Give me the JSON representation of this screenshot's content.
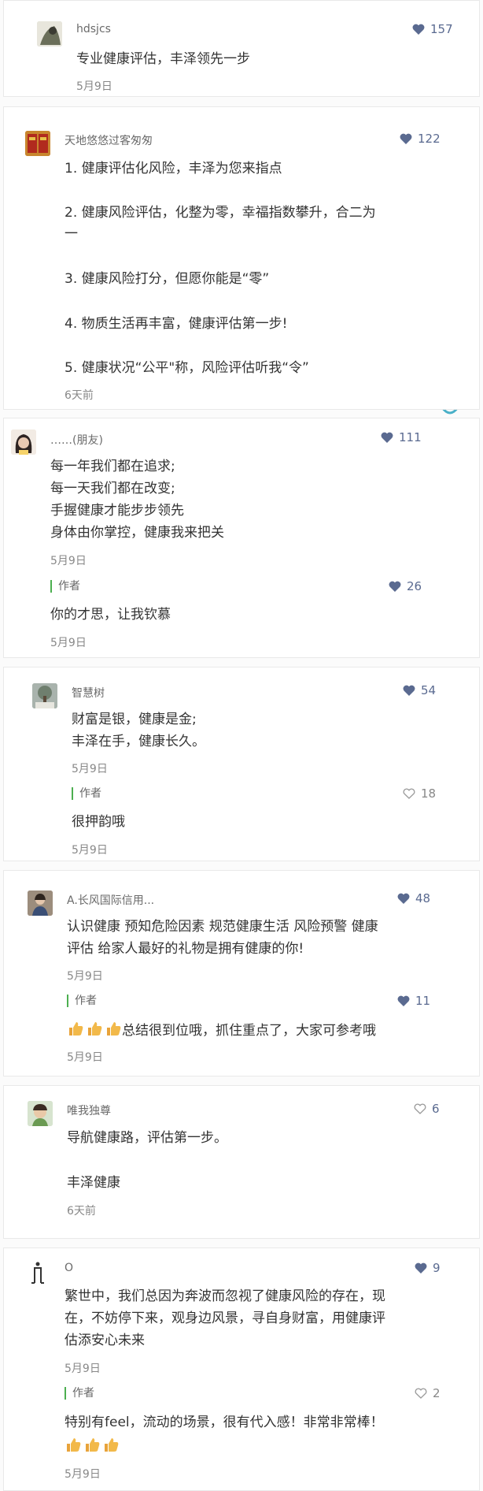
{
  "comments": [
    {
      "user": "hdsjcs",
      "likes": "157",
      "lines": [
        "专业健康评估，丰泽领先一步"
      ],
      "date": "5月9日"
    },
    {
      "user": "天地悠悠过客匆匆",
      "likes": "122",
      "lines": [
        "1.  健康评估化风险，丰泽为您来指点",
        "2.  健康风险评估，化整为零，幸福指数攀升，合二为",
        "一",
        "3.    健康风险打分，但愿你能是“零”",
        "4.    物质生活再丰富，健康评估第一步!",
        "5.    健康状况“公平\"称，风险评估听我“令”"
      ],
      "date": "6天前"
    },
    {
      "user": "……(朋友)",
      "likes": "111",
      "lines": [
        "每一年我们都在追求;",
        "每一天我们都在改变;",
        "手握健康才能步步领先",
        "身体由你掌控，健康我来把关"
      ],
      "date": "5月9日",
      "reply": {
        "tag": "作者",
        "likes": "26",
        "text": "你的才思，让我钦慕",
        "date": "5月9日"
      }
    },
    {
      "user": "智慧树",
      "likes": "54",
      "lines": [
        "财富是银，健康是金;",
        "丰泽在手，健康长久。"
      ],
      "date": "5月9日",
      "reply": {
        "tag": "作者",
        "likes": "18",
        "text": "很押韵哦",
        "date": "5月9日"
      }
    },
    {
      "user": "A.长风国际信用...",
      "likes": "48",
      "lines": [
        "认识健康 预知危险因素 规范健康生活 风险预警 健康",
        "评估 给家人最好的礼物是拥有健康的你!"
      ],
      "date": "5月9日",
      "reply": {
        "tag": "作者",
        "likes": "11",
        "text": "总结很到位哦，抓住重点了，大家可参考哦",
        "date": "5月9日"
      }
    },
    {
      "user": "唯我独尊",
      "likes": "6",
      "lines": [
        "导航健康路，评估第一步。",
        "丰泽健康"
      ],
      "date": "6天前"
    },
    {
      "user": "O",
      "likes": "9",
      "lines": [
        "繁世中，我们总因为奔波而忽视了健康风险的存在，现",
        "在，不妨停下来，观身边风景，寻自身财富，用健康评",
        "估添安心未来"
      ],
      "date": "5月9日",
      "reply": {
        "tag": "作者",
        "likes": "2",
        "text": "特别有feel，流动的场景，很有代入感！非常非常棒！",
        "date": "5月9日"
      }
    }
  ],
  "colors": {
    "like_heart": "#5a6a90",
    "author_bar": "#4caf50"
  }
}
